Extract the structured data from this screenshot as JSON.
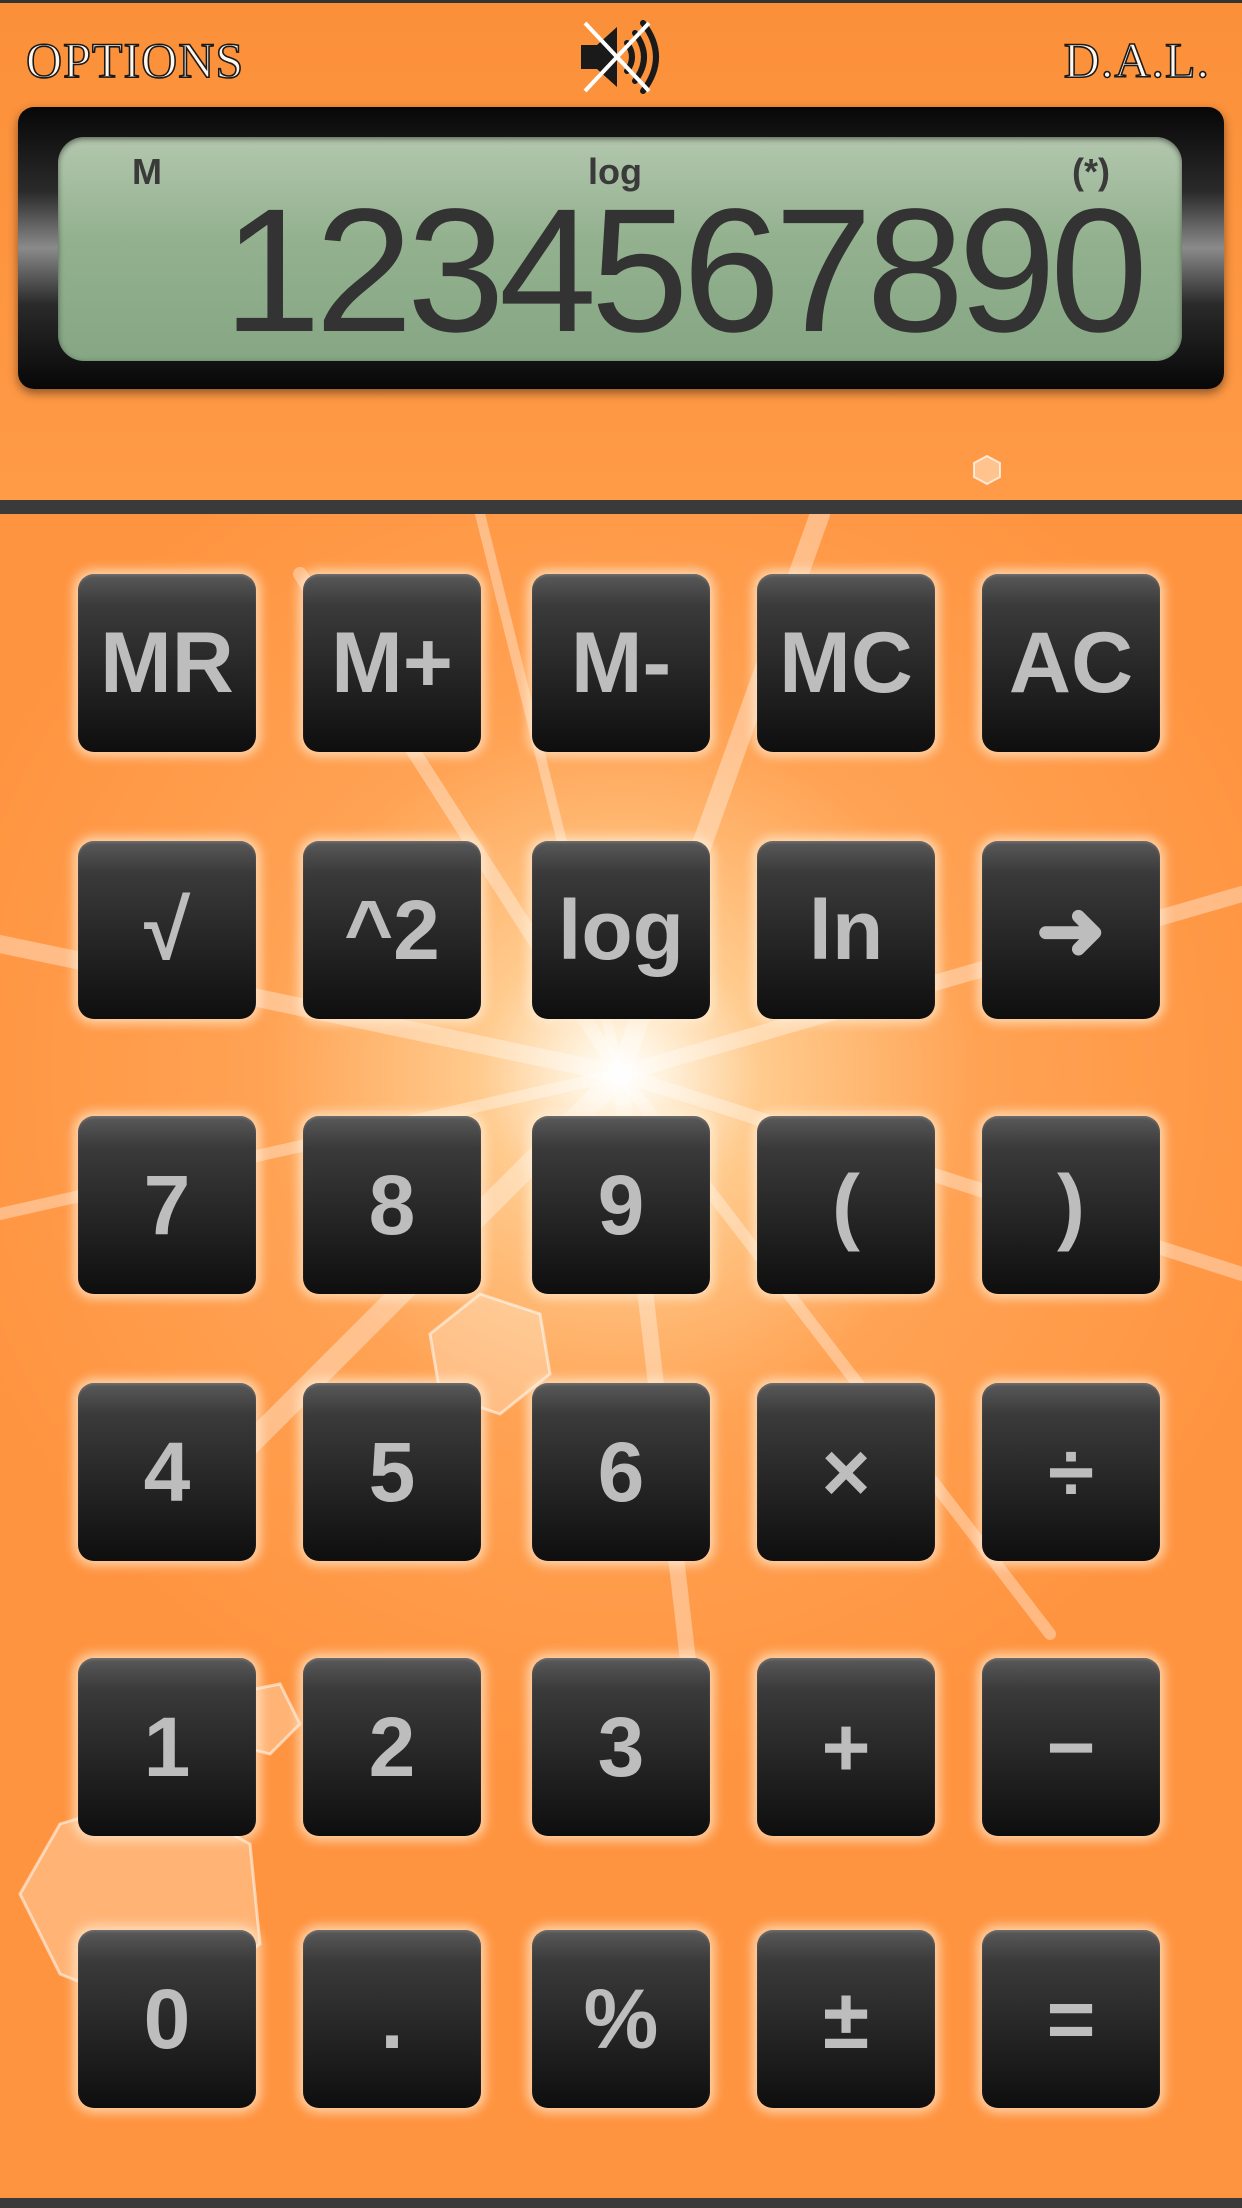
{
  "header": {
    "options_label": "OPTIONS",
    "brand_label": "D.A.L.",
    "sound_icon": "speaker-muted-icon"
  },
  "display": {
    "memory_indicator": "M",
    "mode_indicator": "log",
    "paren_indicator": "(*)",
    "value": "1234567890"
  },
  "keypad": {
    "rows": [
      [
        "MR",
        "M+",
        "M-",
        "MC",
        "AC"
      ],
      [
        "√",
        "^2",
        "log",
        "ln",
        "➜"
      ],
      [
        "7",
        "8",
        "9",
        "(",
        ")"
      ],
      [
        "4",
        "5",
        "6",
        "×",
        "÷"
      ],
      [
        "1",
        "2",
        "3",
        "+",
        "−"
      ],
      [
        "0",
        ".",
        "%",
        "±",
        "="
      ]
    ]
  },
  "colors": {
    "background": "#ff9440",
    "key_face": "#262626",
    "key_text": "#bdbdbd",
    "lcd": "#93b18f",
    "lcd_text": "#333333"
  }
}
